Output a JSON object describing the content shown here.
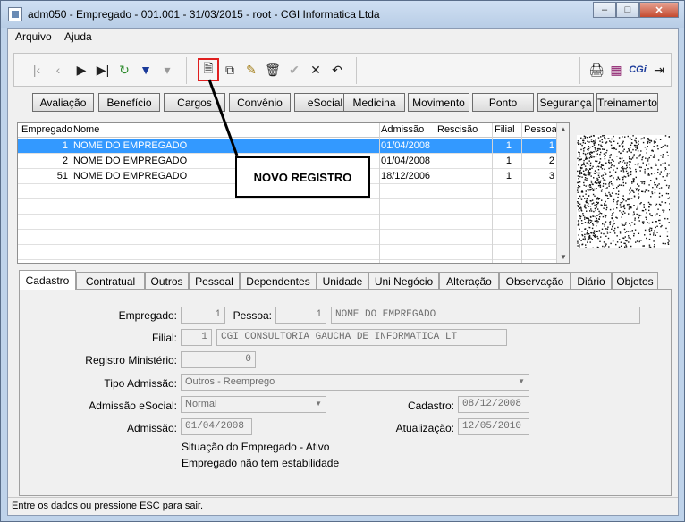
{
  "window": {
    "title": "adm050 - Empregado - 001.001 - 31/03/2015 - root - CGI Informatica Ltda",
    "controls": {
      "minimize": "–",
      "maximize": "□",
      "close": "✕"
    }
  },
  "menu": {
    "arquivo": "Arquivo",
    "ajuda": "Ajuda"
  },
  "toolbar": {
    "icons": [
      "first-icon",
      "previous-icon",
      "next-icon",
      "last-icon",
      "refresh-icon",
      "filter-icon",
      "clear-filter-icon",
      "new-record-icon",
      "copy-icon",
      "edit-icon",
      "delete-icon",
      "confirm-icon",
      "cancel-icon",
      "undo-icon",
      "print-icon",
      "book-icon",
      "cgi-logo",
      "exit-icon"
    ],
    "cgi_label": "CGi"
  },
  "nav_buttons": [
    "Avaliação",
    "Benefício",
    "Cargos",
    "Convênio",
    "eSocial",
    "Medicina",
    "Movimento",
    "Ponto",
    "Segurança",
    "Treinamento"
  ],
  "grid": {
    "columns": [
      "Empregado",
      "Nome",
      "Admissão",
      "Rescisão",
      "Filial",
      "Pessoa"
    ],
    "rows": [
      {
        "empregado": "1",
        "nome": "NOME DO EMPREGADO",
        "admissao": "01/04/2008",
        "rescisao": "",
        "filial": "1",
        "pessoa": "1"
      },
      {
        "empregado": "2",
        "nome": "NOME DO EMPREGADO",
        "admissao": "01/04/2008",
        "rescisao": "",
        "filial": "1",
        "pessoa": "2"
      },
      {
        "empregado": "51",
        "nome": "NOME DO EMPREGADO",
        "admissao": "18/12/2006",
        "rescisao": "",
        "filial": "1",
        "pessoa": "3"
      }
    ]
  },
  "callout": "NOVO REGISTRO",
  "tabs": [
    "Cadastro",
    "Contratual",
    "Outros",
    "Pessoal",
    "Dependentes",
    "Unidade",
    "Uni Negócio",
    "Alteração",
    "Observação",
    "Diário",
    "Objetos"
  ],
  "form": {
    "empregado_label": "Empregado:",
    "empregado_value": "1",
    "pessoa_label": "Pessoa:",
    "pessoa_value": "1",
    "pessoa_nome": "NOME DO EMPREGADO",
    "filial_label": "Filial:",
    "filial_value": "1",
    "filial_nome": "CGI CONSULTORIA GAUCHA DE INFORMATICA LT",
    "registro_label": "Registro Ministério:",
    "registro_value": "0",
    "tipo_admissao_label": "Tipo Admissão:",
    "tipo_admissao_value": "Outros - Reemprego",
    "admissao_esocial_label": "Admissão eSocial:",
    "admissao_esocial_value": "Normal",
    "cadastro_label": "Cadastro:",
    "cadastro_value": "08/12/2008",
    "admissao_label": "Admissão:",
    "admissao_value": "01/04/2008",
    "atualizacao_label": "Atualização:",
    "atualizacao_value": "12/05/2010",
    "situacao": "Situação do Empregado - Ativo",
    "estabilidade": "Empregado não tem estabilidade"
  },
  "status": "Entre os dados ou pressione ESC para sair.",
  "colors": {
    "selection": "#3399ff",
    "highlight": "#e02020",
    "title_bg": "#bfd3ea"
  }
}
